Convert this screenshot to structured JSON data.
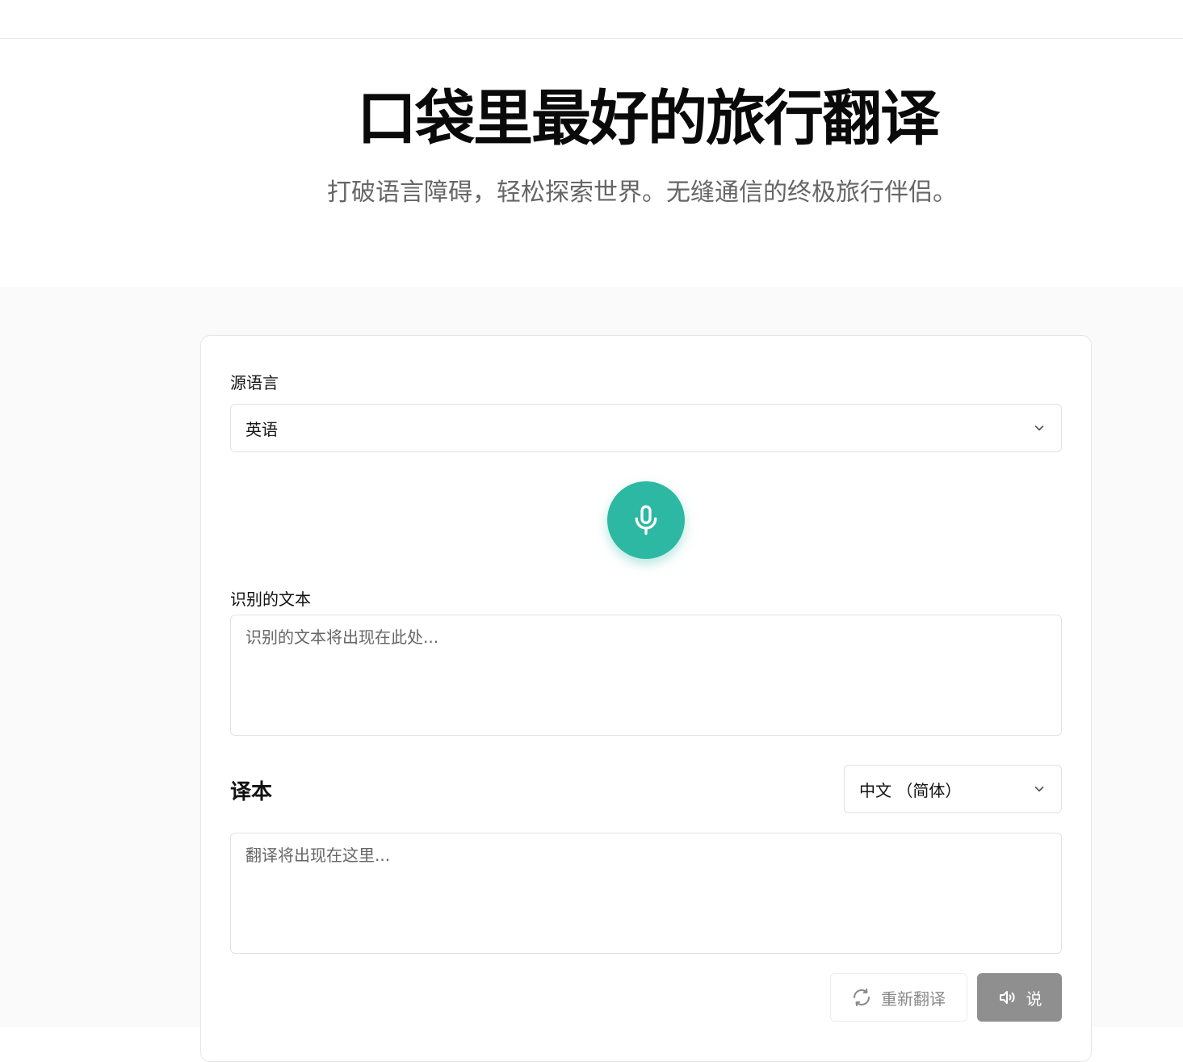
{
  "hero": {
    "title": "口袋里最好的旅行翻译",
    "subtitle": "打破语言障碍，轻松探索世界。无缝通信的终极旅行伴侣。"
  },
  "source": {
    "label": "源语言",
    "selected": "英语",
    "icon": "chevron-down-icon"
  },
  "mic": {
    "icon": "microphone-icon",
    "color": "#2db8a3"
  },
  "recognized": {
    "label": "识别的文本",
    "placeholder": "识别的文本将出现在此处..."
  },
  "translation": {
    "title": "译本",
    "target_selected": "中文 （简体）",
    "placeholder": "翻译将出现在这里..."
  },
  "actions": {
    "retranslate_label": "重新翻译",
    "retranslate_icon": "refresh-icon",
    "speak_label": "说",
    "speak_icon": "speaker-icon"
  }
}
